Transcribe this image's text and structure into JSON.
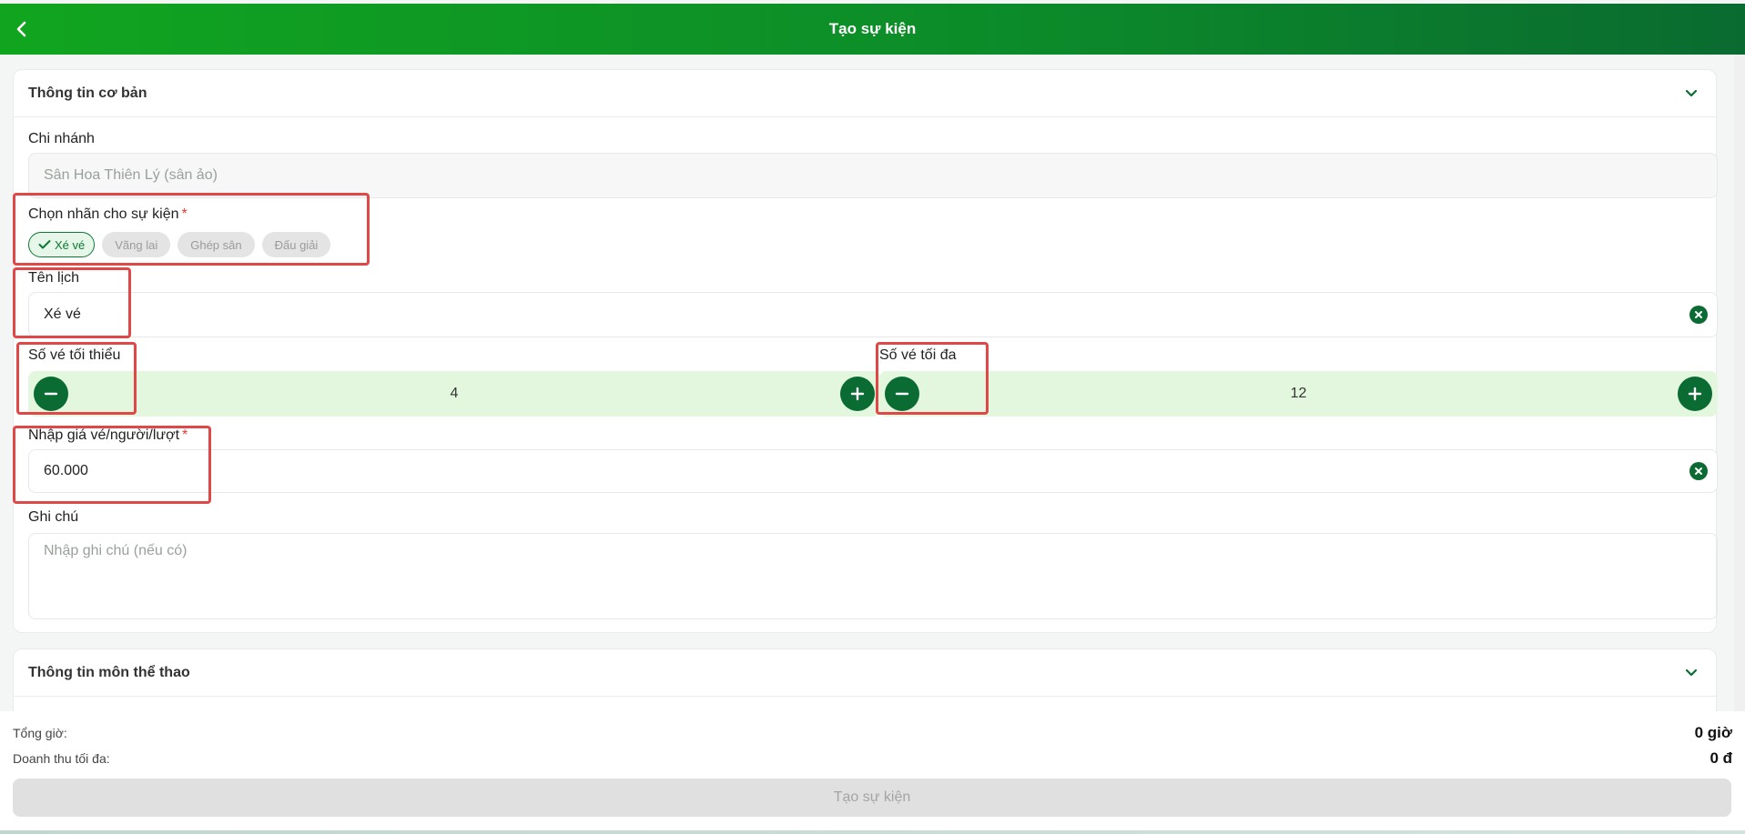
{
  "header": {
    "title": "Tạo sự kiện"
  },
  "basic": {
    "section_title": "Thông tin cơ bản",
    "branch_label": "Chi nhánh",
    "branch_value": "Sân Hoa Thiên Lý (sân ảo)",
    "tags_label": "Chọn nhãn cho sự kiện",
    "required_mark": "*",
    "tags": [
      {
        "label": "Xé vé",
        "active": true
      },
      {
        "label": "Vãng lai",
        "active": false
      },
      {
        "label": "Ghép sân",
        "active": false
      },
      {
        "label": "Đấu giải",
        "active": false
      }
    ],
    "name_label": "Tên lịch",
    "name_value": "Xé vé",
    "min_label": "Số vé tối thiểu",
    "min_value": "4",
    "max_label": "Số vé tối đa",
    "max_value": "12",
    "price_label": "Nhập giá vé/người/lượt",
    "price_value": "60.000",
    "note_label": "Ghi chú",
    "note_placeholder": "Nhập ghi chú (nếu có)"
  },
  "sport": {
    "section_title": "Thông tin môn thể thao"
  },
  "footer": {
    "total_hours_label": "Tổng giờ:",
    "total_hours_value": "0 giờ",
    "max_revenue_label": "Doanh thu tối đa:",
    "max_revenue_value": "0 đ",
    "submit_label": "Tạo sự kiện"
  },
  "colors": {
    "primary": "#0a6b33",
    "stepper_bg": "#e2f7de",
    "highlight": "#e04848"
  }
}
